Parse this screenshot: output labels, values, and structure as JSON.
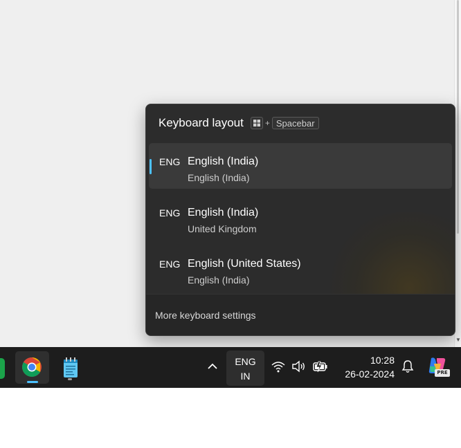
{
  "flyout": {
    "title": "Keyboard layout",
    "shortcut": {
      "win_key": "windows-logo-icon",
      "plus": "+",
      "space_key": "Spacebar"
    },
    "layouts": [
      {
        "code": "ENG",
        "name": "English (India)",
        "keyboard": "English (India)",
        "selected": true
      },
      {
        "code": "ENG",
        "name": "English (India)",
        "keyboard": "United Kingdom",
        "selected": false
      },
      {
        "code": "ENG",
        "name": "English (United States)",
        "keyboard": "English (India)",
        "selected": false
      }
    ],
    "more_settings_label": "More keyboard settings"
  },
  "taskbar": {
    "apps": [
      {
        "name": "chrome",
        "icon": "chrome-icon",
        "active": true
      },
      {
        "name": "notepad",
        "icon": "notepad-icon",
        "active": false
      }
    ],
    "language": {
      "line1": "ENG",
      "line2": "IN"
    },
    "system_icons": [
      "chevron-up-icon",
      "wifi-icon",
      "volume-icon",
      "battery-charging-icon"
    ],
    "clock": {
      "time": "10:28",
      "date": "26-02-2024"
    },
    "copilot_badge": "PRE"
  },
  "colors": {
    "accent": "#4cc2ff",
    "flyout_bg": "#2c2c2c",
    "taskbar_bg": "#1d1d1d",
    "desktop_bg": "#efefef"
  }
}
